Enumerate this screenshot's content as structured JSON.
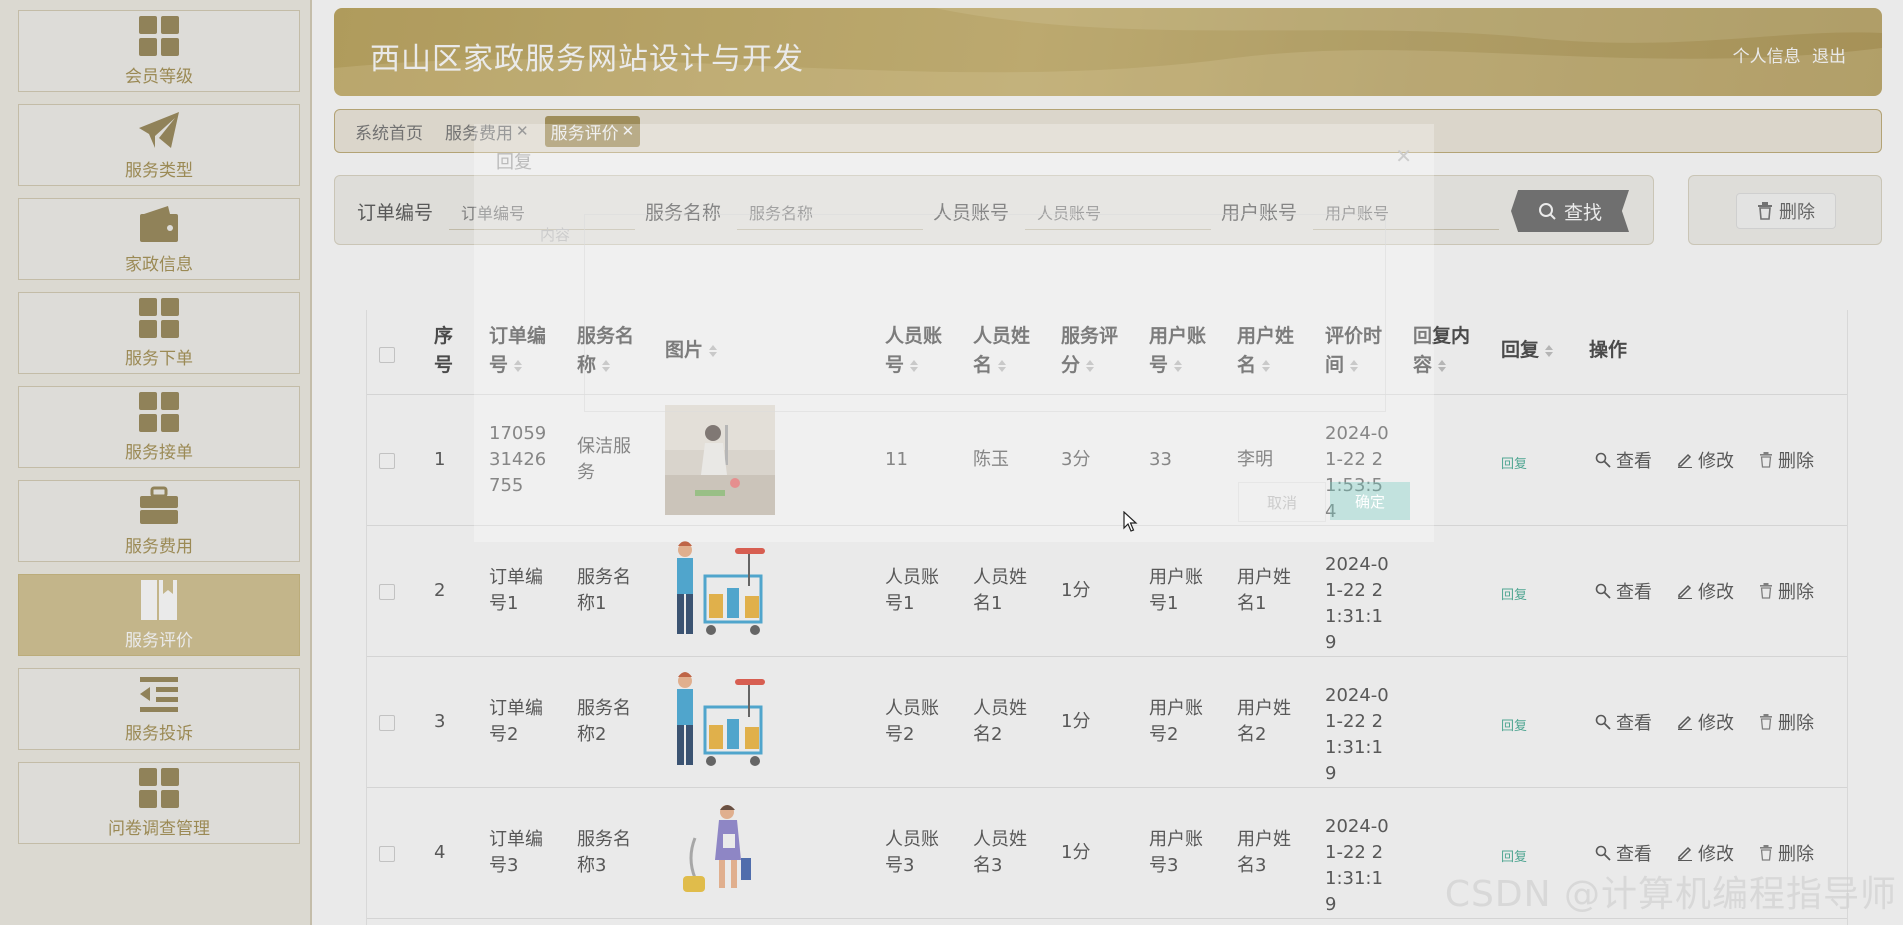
{
  "sidebar": {
    "items": [
      {
        "label": "会员等级",
        "icon": "grid-icon",
        "active": false
      },
      {
        "label": "服务类型",
        "icon": "paper-plane-icon",
        "active": false
      },
      {
        "label": "家政信息",
        "icon": "wallet-icon",
        "active": false
      },
      {
        "label": "服务下单",
        "icon": "grid-icon",
        "active": false
      },
      {
        "label": "服务接单",
        "icon": "grid-icon",
        "active": false
      },
      {
        "label": "服务费用",
        "icon": "briefcase-icon",
        "active": false
      },
      {
        "label": "服务评价",
        "icon": "bookmark-book-icon",
        "active": true
      },
      {
        "label": "服务投诉",
        "icon": "indent-list-icon",
        "active": false
      },
      {
        "label": "问卷调查管理",
        "icon": "grid-icon",
        "active": false
      }
    ]
  },
  "header": {
    "title": "西山区家政服务网站设计与开发",
    "profile_link": "个人信息",
    "logout_link": "退出"
  },
  "tabs": [
    {
      "label": "系统首页",
      "closable": false,
      "active": false
    },
    {
      "label": "服务费用",
      "closable": true,
      "active": false
    },
    {
      "label": "服务评价",
      "closable": true,
      "active": true
    }
  ],
  "search": {
    "order_no_label": "订单编号",
    "order_no_placeholder": "订单编号",
    "service_name_label": "服务名称",
    "service_name_placeholder": "服务名称",
    "staff_account_label": "人员账号",
    "staff_account_placeholder": "人员账号",
    "user_account_label": "用户账号",
    "user_account_placeholder": "用户账号",
    "search_button": "查找",
    "delete_button": "删除"
  },
  "table": {
    "headers": {
      "index": "序号",
      "order_no": "订单编号",
      "service_name": "服务名称",
      "image": "图片",
      "staff_account": "人员账号",
      "staff_name": "人员姓名",
      "score": "服务评分",
      "user_account": "用户账号",
      "user_name": "用户姓名",
      "eval_time": "评价时间",
      "reply_content": "回复内容",
      "reply": "回复",
      "ops": "操作"
    },
    "rows": [
      {
        "index": "1",
        "order_no": "1705931426755",
        "service_name": "保洁服务",
        "image": "photo-cleaning-kitchen",
        "staff_account": "11",
        "staff_name": "陈玉",
        "score": "3分",
        "user_account": "33",
        "user_name": "李明",
        "eval_time": "2024-01-22 21:53:54",
        "reply_content": ""
      },
      {
        "index": "2",
        "order_no": "订单编号1",
        "service_name": "服务名称1",
        "image": "cleaner-cart-illustration",
        "staff_account": "人员账号1",
        "staff_name": "人员姓名1",
        "score": "1分",
        "user_account": "用户账号1",
        "user_name": "用户姓名1",
        "eval_time": "2024-01-22 21:31:19",
        "reply_content": ""
      },
      {
        "index": "3",
        "order_no": "订单编号2",
        "service_name": "服务名称2",
        "image": "cleaner-cart-illustration",
        "staff_account": "人员账号2",
        "staff_name": "人员姓名2",
        "score": "1分",
        "user_account": "用户账号2",
        "user_name": "用户姓名2",
        "eval_time": "2024-01-22 21:31:19",
        "reply_content": ""
      },
      {
        "index": "4",
        "order_no": "订单编号3",
        "service_name": "服务名称3",
        "image": "cleaner-vacuum-illustration",
        "staff_account": "人员账号3",
        "staff_name": "人员姓名3",
        "score": "1分",
        "user_account": "用户账号3",
        "user_name": "用户姓名3",
        "eval_time": "2024-01-22 21:31:19",
        "reply_content": ""
      }
    ],
    "reply_link": "回复",
    "op_view": "查看",
    "op_edit": "修改",
    "op_delete": "删除"
  },
  "modal": {
    "title": "回复",
    "content_label": "内容",
    "cancel": "取消",
    "confirm": "确定"
  },
  "watermark": "CSDN @计算机编程指导师",
  "colors": {
    "brand_gold": "#b49a4a",
    "active_menu": "#cdbb85",
    "reply_teal": "#3aa88f",
    "search_button": "#626262"
  }
}
